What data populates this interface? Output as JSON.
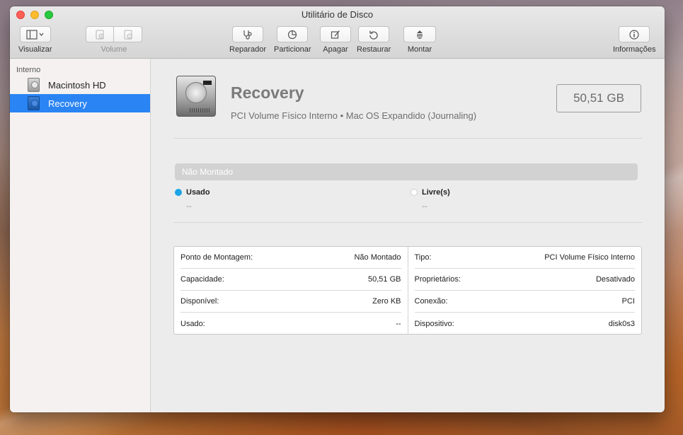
{
  "window": {
    "title": "Utilitário de Disco"
  },
  "toolbar": {
    "view_label": "Visualizar",
    "volume_label": "Volume",
    "firstaid_label": "Reparador",
    "partition_label": "Particionar",
    "erase_label": "Apagar",
    "restore_label": "Restaurar",
    "mount_label": "Montar",
    "info_label": "Informações"
  },
  "sidebar": {
    "section_label": "Interno",
    "items": [
      {
        "label": "Macintosh HD",
        "selected": false
      },
      {
        "label": "Recovery",
        "selected": true
      }
    ]
  },
  "volume": {
    "name": "Recovery",
    "description": "PCI Volume Físico Interno • Mac OS Expandido (Journaling)",
    "size": "50,51 GB",
    "status": "Não Montado"
  },
  "legend": {
    "used": {
      "label": "Usado",
      "value": "--",
      "color": "#1ba4e6"
    },
    "free": {
      "label": "Livre(s)",
      "value": "--",
      "color": "#ffffff"
    }
  },
  "info": {
    "left": [
      {
        "key": "Ponto de Montagem:",
        "value": "Não Montado"
      },
      {
        "key": "Capacidade:",
        "value": "50,51 GB"
      },
      {
        "key": "Disponível:",
        "value": "Zero KB"
      },
      {
        "key": "Usado:",
        "value": "--"
      }
    ],
    "right": [
      {
        "key": "Tipo:",
        "value": "PCI Volume Físico Interno"
      },
      {
        "key": "Proprietários:",
        "value": "Desativado"
      },
      {
        "key": "Conexão:",
        "value": "PCI"
      },
      {
        "key": "Dispositivo:",
        "value": "disk0s3"
      }
    ]
  }
}
